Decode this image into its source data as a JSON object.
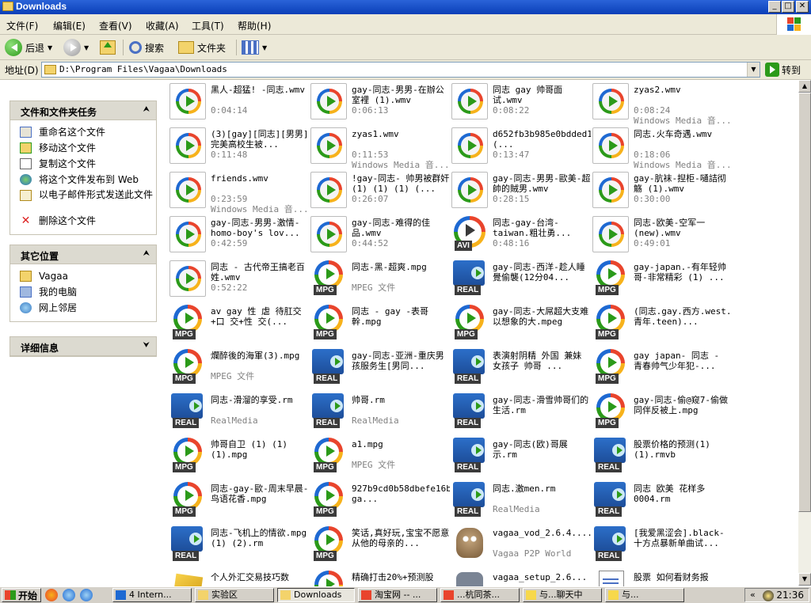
{
  "window": {
    "title": "Downloads"
  },
  "menu": [
    "文件(F)",
    "编辑(E)",
    "查看(V)",
    "收藏(A)",
    "工具(T)",
    "帮助(H)"
  ],
  "toolbar": {
    "back": "后退",
    "search": "搜索",
    "folders": "文件夹"
  },
  "address": {
    "label": "地址(D)",
    "path": "D:\\Program Files\\Vagaa\\Downloads",
    "go": "转到"
  },
  "taskpanel": {
    "tasks_title": "文件和文件夹任务",
    "tasks": [
      {
        "label": "重命名这个文件",
        "icon": "rename-icon"
      },
      {
        "label": "移动这个文件",
        "icon": "move-icon"
      },
      {
        "label": "复制这个文件",
        "icon": "copy-icon"
      },
      {
        "label": "将这个文件发布到 Web",
        "icon": "web-publish-icon"
      },
      {
        "label": "以电子邮件形式发送此文件",
        "icon": "email-icon"
      },
      {
        "label": "删除这个文件",
        "icon": "delete-icon"
      }
    ],
    "places_title": "其它位置",
    "places": [
      {
        "label": "Vagaa",
        "icon": "folder-icon"
      },
      {
        "label": "我的电脑",
        "icon": "my-computer-icon"
      },
      {
        "label": "网上邻居",
        "icon": "network-icon"
      }
    ],
    "details_title": "详细信息"
  },
  "files": [
    {
      "name": "黑人-超猛! -同志.wmv",
      "sub": "0:04:14",
      "type": "wmv"
    },
    {
      "name": "gay-同志-男男-在辦公室裡 (1).wmv",
      "sub": "0:06:13",
      "type": "wmv"
    },
    {
      "name": "同志 gay 帅哥面试.wmv",
      "sub": "0:08:22",
      "type": "wmv"
    },
    {
      "name": "zyas2.wmv",
      "sub": "0:08:24",
      "sub2": "Windows Media 音...",
      "type": "wmv"
    },
    {
      "name": "(3)[gay][同志][男男]完美高校生被...",
      "sub": "0:11:48",
      "type": "wmv"
    },
    {
      "name": "zyas1.wmv",
      "sub": "0:11:53",
      "sub2": "Windows Media 音...",
      "type": "wmv"
    },
    {
      "name": "d652fb3b985e0bdded1196e1afcccbd4 (...",
      "sub": "0:13:47",
      "type": "wmv"
    },
    {
      "name": "同志.火车奇遇.wmv",
      "sub": "0:18:06",
      "sub2": "Windows Media 音...",
      "type": "wmv"
    },
    {
      "name": "friends.wmv",
      "sub": "0:23:59",
      "sub2": "Windows Media 音...",
      "type": "wmv"
    },
    {
      "name": "!gay-同志- 帅男被群奸 (1) (1) (1) (...",
      "sub": "0:26:07",
      "type": "wmv"
    },
    {
      "name": "gay-同志-男男-歐美-超帥的賊男.wmv",
      "sub": "0:28:15",
      "type": "wmv"
    },
    {
      "name": "gay-肮袜-揑柜-嗵詰彻觞 (1).wmv",
      "sub": "0:30:00",
      "type": "wmv"
    },
    {
      "name": "gay-同志-男男-激情-homo-boy's lov...",
      "sub": "0:42:59",
      "type": "wmv"
    },
    {
      "name": "gay-同志-难得的佳品.wmv",
      "sub": "0:44:52",
      "type": "wmv"
    },
    {
      "name": "同志-gay-台湾-taiwan.粗壮勇...",
      "sub": "0:48:16",
      "type": "avi"
    },
    {
      "name": "同志-欧美-空军一(new).wmv",
      "sub": "0:49:01",
      "type": "wmv"
    },
    {
      "name": "同志 - 古代帝王搞老百姓.wmv",
      "sub": "0:52:22",
      "type": "wmv"
    },
    {
      "name": "同志-黑-超爽.mpg",
      "sub": "MPEG 文件",
      "type": "mpg"
    },
    {
      "name": "gay-同志-西洋-趁人睡覺偷襲(12分04...",
      "sub": "",
      "type": "real"
    },
    {
      "name": "gay-japan.-有年轻帅哥-非常精彩 (1) ...",
      "sub": "",
      "type": "mpg"
    },
    {
      "name": "av gay 性 虐 待肛交+口 交+性 交(...",
      "sub": "",
      "type": "mpg"
    },
    {
      "name": "同志 - gay -表哥幹.mpg",
      "sub": "",
      "type": "mpg"
    },
    {
      "name": "gay-同志-大屌超大支难以想象的大.mpeg",
      "sub": "",
      "type": "mpg"
    },
    {
      "name": "(同志.gay.西方.west.青年.teen)...",
      "sub": "",
      "type": "mpg"
    },
    {
      "name": "爛醉後的海軍(3).mpg",
      "sub": "MPEG 文件",
      "type": "mpg"
    },
    {
      "name": "gay-同志-亚洲-重庆男孩服务生[男同...",
      "sub": "",
      "type": "real"
    },
    {
      "name": "表演射阴精 外国 兼妹 女孩子 帅哥 ...",
      "sub": "",
      "type": "real"
    },
    {
      "name": "gay japan- 同志 - 青春帅气少年犯-...",
      "sub": "",
      "type": "mpg"
    },
    {
      "name": "同志-滑溜的享受.rm",
      "sub": "RealMedia",
      "type": "real"
    },
    {
      "name": "帅哥.rm",
      "sub": "RealMedia",
      "type": "real"
    },
    {
      "name": "gay-同志-滑雪帅哥们的生活.rm",
      "sub": "",
      "type": "real"
    },
    {
      "name": "gay-同志-偷@窥7-偷做同伴反被上.mpg",
      "sub": "",
      "type": "mpg"
    },
    {
      "name": "帅哥自卫 (1) (1)(1).mpg",
      "sub": "",
      "type": "mpg"
    },
    {
      "name": "a1.mpg",
      "sub": "MPEG 文件",
      "type": "mpg"
    },
    {
      "name": "gay-同志(欧)哥展示.rm",
      "sub": "",
      "type": "real"
    },
    {
      "name": "股票价格的预测(1)(1).rmvb",
      "sub": "",
      "type": "real"
    },
    {
      "name": "同志-gay-歐-周末早晨-鸟语花香.mpg",
      "sub": "",
      "type": "mpg"
    },
    {
      "name": "927b9cd0b58dbefe16bfe0e36464b369 ga...",
      "sub": "",
      "type": "mpg"
    },
    {
      "name": "同志.激men.rm",
      "sub": "RealMedia",
      "type": "real"
    },
    {
      "name": "同志 欧美 花样多0004.rm",
      "sub": "",
      "type": "real"
    },
    {
      "name": "同志-飞机上的情欲.mpg (1) (2).rm",
      "sub": "",
      "type": "real"
    },
    {
      "name": "笑话,真好玩,宝宝不愿意从他的母亲的...",
      "sub": "",
      "type": "mpg"
    },
    {
      "name": "vagaa_vod_2.6.4....",
      "sub": "Vagaa P2P World",
      "type": "vagaa"
    },
    {
      "name": "[我爱黑涩会].black-十方点暴新单曲试...",
      "sub": "",
      "type": "real"
    },
    {
      "name": "个人外汇交易技巧数",
      "sub": "",
      "type": "zip"
    },
    {
      "name": "精确打击20%+预测股",
      "sub": "",
      "type": "mpg"
    },
    {
      "name": "vagaa_setup_2.6...",
      "sub": "",
      "type": "blur"
    },
    {
      "name": "股票 如何看财务报",
      "sub": "",
      "type": "doc"
    }
  ],
  "taskbar": {
    "start": "开始",
    "tasks": [
      {
        "label": "4 Intern...",
        "active": false
      },
      {
        "label": "实验区",
        "active": false
      },
      {
        "label": "Downloads",
        "active": true
      },
      {
        "label": "淘宝网 -- ...",
        "active": false
      },
      {
        "label": "...杭同茶...",
        "active": false
      },
      {
        "label": "与...聊天中",
        "active": false
      },
      {
        "label": "与...",
        "active": false
      }
    ],
    "clock": "21:36"
  }
}
